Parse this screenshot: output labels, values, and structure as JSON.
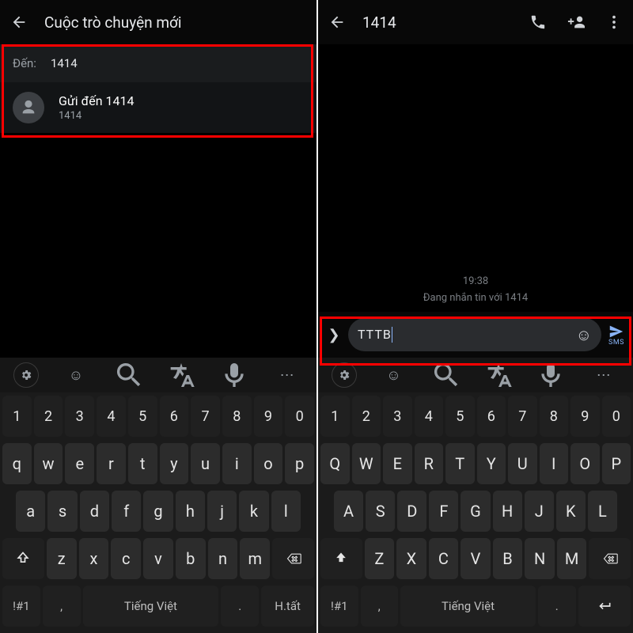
{
  "left": {
    "topbar_title": "Cuộc trò chuyện mới",
    "to_label": "Đến:",
    "to_value": "1414",
    "suggestion_title": "Gửi đến 1414",
    "suggestion_sub": "1414"
  },
  "right": {
    "topbar_title": "1414",
    "time": "19:38",
    "banner": "Đang nhắn tin với 1414",
    "compose_text": "TTTB",
    "send_sub": "SMS"
  },
  "keyboard": {
    "nums": [
      "1",
      "2",
      "3",
      "4",
      "5",
      "6",
      "7",
      "8",
      "9",
      "0"
    ],
    "row1_lower": [
      "q",
      "w",
      "e",
      "r",
      "t",
      "y",
      "u",
      "i",
      "o",
      "p"
    ],
    "row2_lower": [
      "a",
      "s",
      "d",
      "f",
      "g",
      "h",
      "j",
      "k",
      "l"
    ],
    "row3_lower": [
      "z",
      "x",
      "c",
      "v",
      "b",
      "n",
      "m"
    ],
    "row1_upper": [
      "Q",
      "W",
      "E",
      "R",
      "T",
      "Y",
      "U",
      "I",
      "O",
      "P"
    ],
    "row2_upper": [
      "A",
      "S",
      "D",
      "F",
      "G",
      "H",
      "J",
      "K",
      "L"
    ],
    "row3_upper": [
      "Z",
      "X",
      "C",
      "V",
      "B",
      "N",
      "M"
    ],
    "symbol_key": "!#1",
    "lang_label": "Tiếng Việt",
    "done_label_left": "H.tất",
    "comma": ",",
    "period": "."
  }
}
